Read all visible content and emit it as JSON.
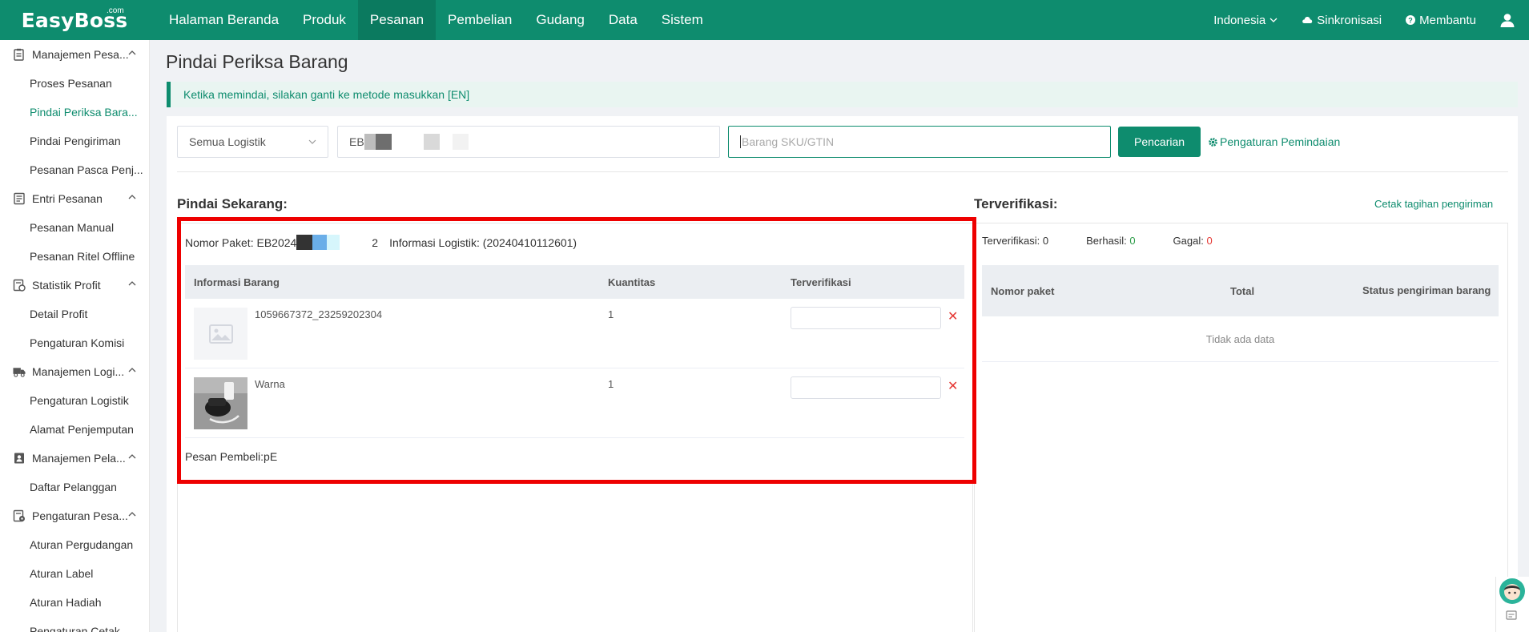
{
  "brand": {
    "logo": "EasyBoss",
    "logo_sup": ".com"
  },
  "nav": [
    {
      "label": "Halaman Beranda"
    },
    {
      "label": "Produk"
    },
    {
      "label": "Pesanan"
    },
    {
      "label": "Pembelian"
    },
    {
      "label": "Gudang"
    },
    {
      "label": "Data"
    },
    {
      "label": "Sistem"
    }
  ],
  "top_right": {
    "language": "Indonesia",
    "sync": "Sinkronisasi",
    "help": "Membantu"
  },
  "sidebar": {
    "groups": [
      {
        "label": "Manajemen Pesa...",
        "items": [
          "Proses Pesanan",
          "Pindai Periksa Bara...",
          "Pindai Pengiriman",
          "Pesanan Pasca Penj..."
        ]
      },
      {
        "label": "Entri Pesanan",
        "items": [
          "Pesanan Manual",
          "Pesanan Ritel Offline"
        ]
      },
      {
        "label": "Statistik Profit",
        "items": [
          "Detail Profit",
          "Pengaturan Komisi"
        ]
      },
      {
        "label": "Manajemen Logi...",
        "items": [
          "Pengaturan Logistik",
          "Alamat Penjemputan"
        ]
      },
      {
        "label": "Manajemen Pela...",
        "items": [
          "Daftar Pelanggan"
        ]
      },
      {
        "label": "Pengaturan Pesa...",
        "items": [
          "Aturan Pergudangan",
          "Aturan Label",
          "Aturan Hadiah",
          "Pengaturan Cetak..."
        ]
      }
    ]
  },
  "page": {
    "title": "Pindai Periksa Barang",
    "alert": "Ketika memindai, silakan ganti ke metode masukkan [EN]"
  },
  "toolbar": {
    "logistics_select": "Semua Logistik",
    "package_input_prefix": "EB",
    "sku_placeholder": "Barang SKU/GTIN",
    "search_button": "Pencarian",
    "scan_settings": "Pengaturan Pemindaian"
  },
  "scan_now": {
    "title": "Pindai Sekarang:",
    "package_label": "Nomor Paket: EB2024",
    "package_suffix": "2",
    "logistics_info": "Informasi Logistik: (20240410112601)",
    "columns": [
      "Informasi Barang",
      "Kuantitas",
      "Terverifikasi"
    ],
    "rows": [
      {
        "name": "1059667372_23259202304",
        "qty": "1"
      },
      {
        "name": "Warna",
        "qty": "1"
      }
    ],
    "buyer_message": "Pesan Pembeli:pE"
  },
  "verified": {
    "title": "Terverifikasi:",
    "print_link": "Cetak tagihan pengiriman",
    "stat_verified_label": "Terverifikasi:",
    "stat_verified_value": "0",
    "stat_success_label": "Berhasil:",
    "stat_success_value": "0",
    "stat_fail_label": "Gagal:",
    "stat_fail_value": "0",
    "columns": [
      "Nomor paket",
      "Total",
      "Status pengiriman barang"
    ],
    "empty": "Tidak ada data"
  },
  "colors": {
    "brand": "#0e8c6e",
    "highlight": "#ee0000",
    "success": "#2e9d4a",
    "fail": "#e53935"
  }
}
